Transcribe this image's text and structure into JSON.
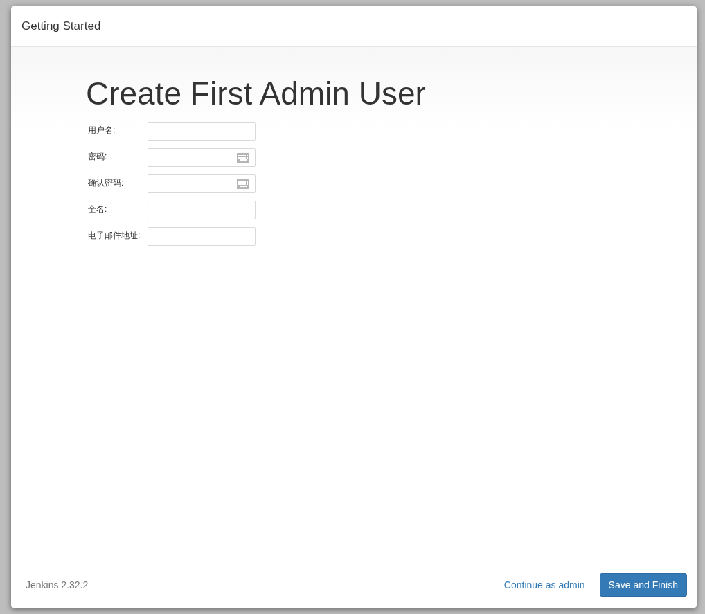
{
  "dialog": {
    "title": "Getting Started"
  },
  "heading": "Create First Admin User",
  "fields": [
    {
      "label": "用户名:",
      "kind": "text"
    },
    {
      "label": "密码:",
      "kind": "password"
    },
    {
      "label": "确认密码:",
      "kind": "password"
    },
    {
      "label": "全名:",
      "kind": "text"
    },
    {
      "label": "电子邮件地址:",
      "kind": "text"
    }
  ],
  "footer": {
    "version": "Jenkins 2.32.2",
    "link": "Continue as admin",
    "button": "Save and Finish"
  }
}
